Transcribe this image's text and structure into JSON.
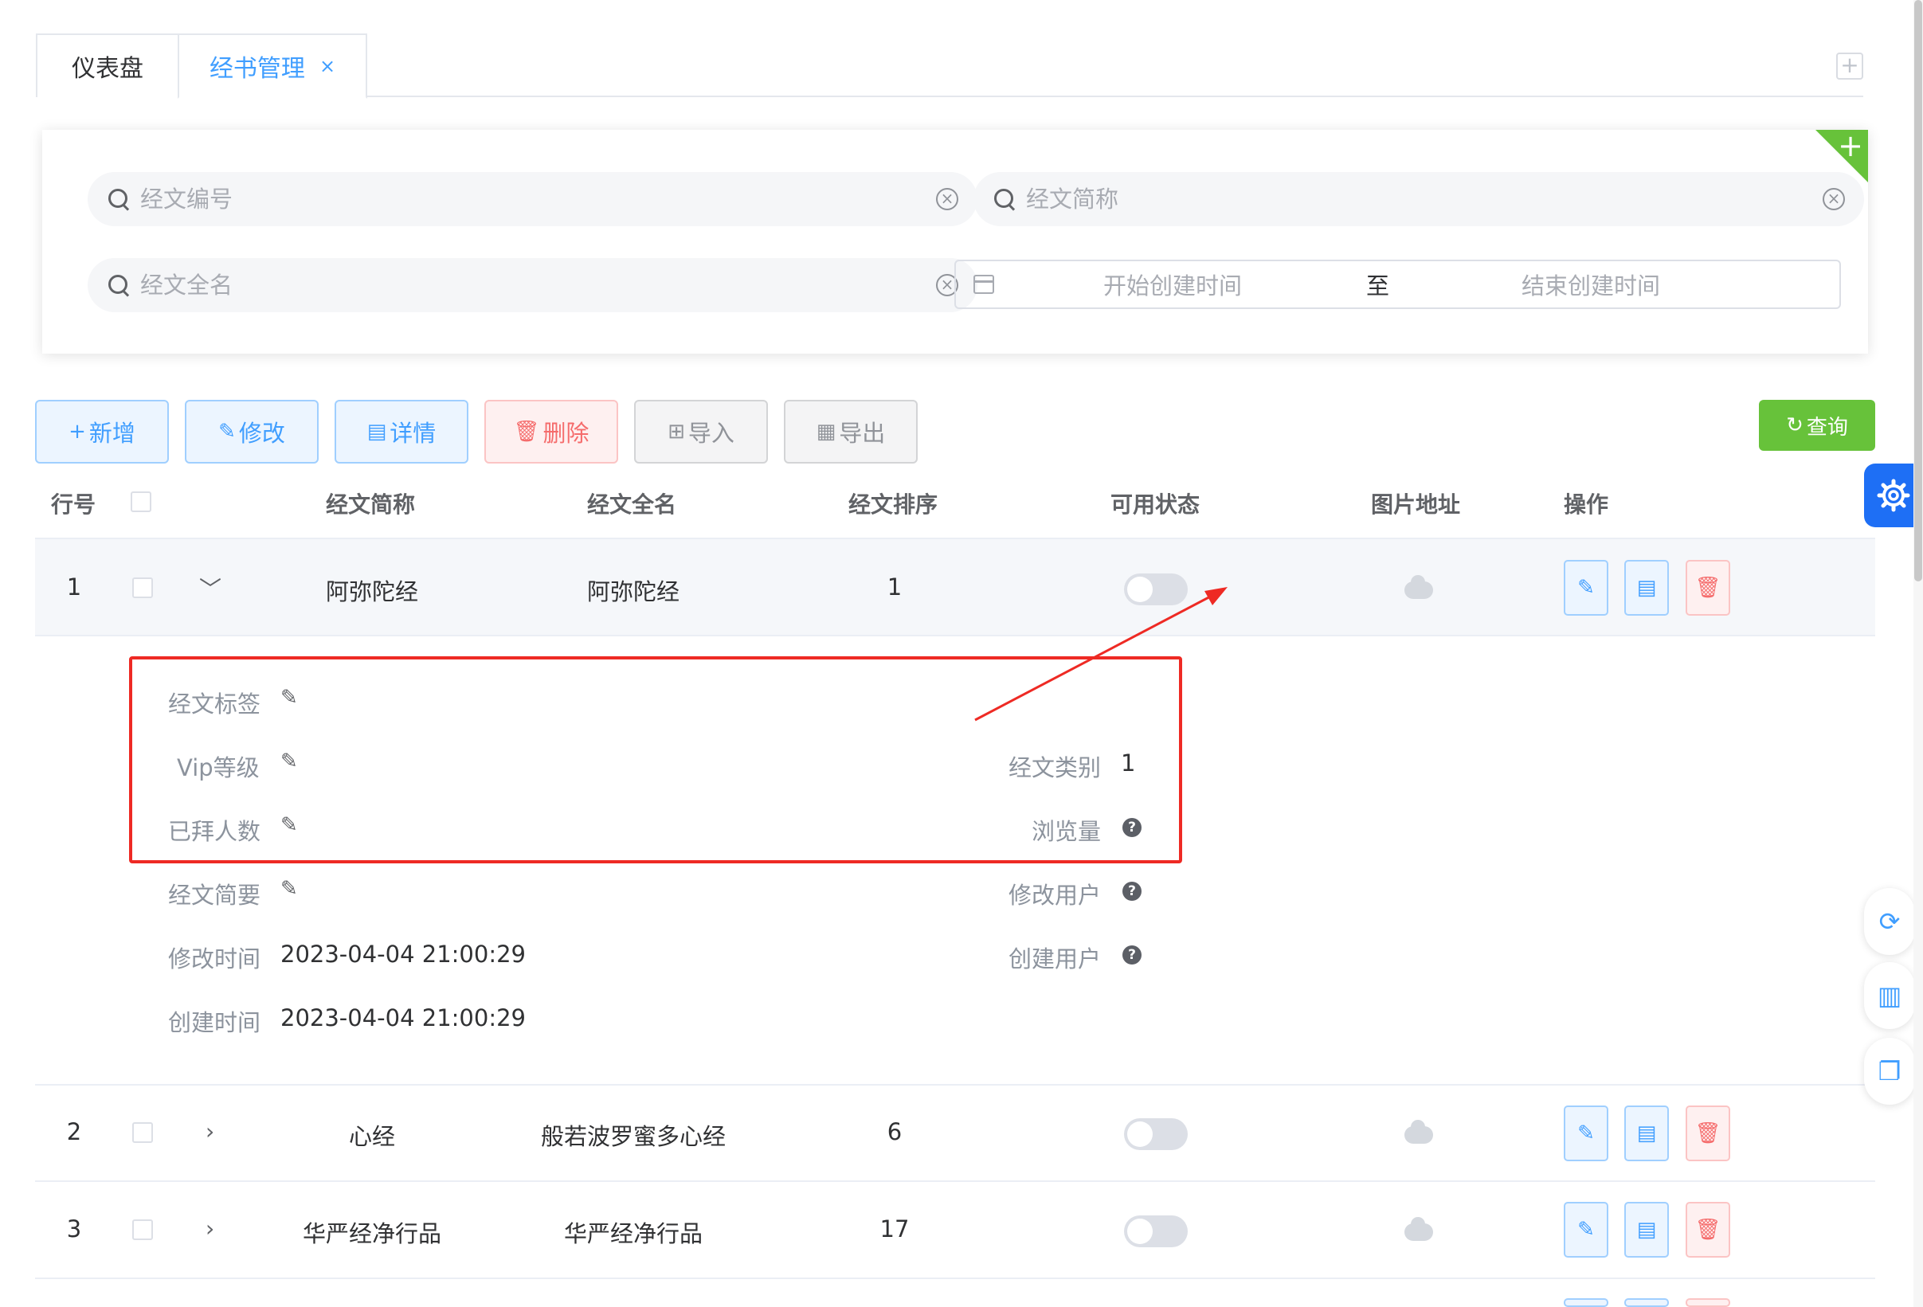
{
  "tabs": [
    {
      "label": "仪表盘"
    },
    {
      "label": "经书管理",
      "close": "×"
    }
  ],
  "search": {
    "number_placeholder": "经文编号",
    "short_name_placeholder": "经文简称",
    "full_name_placeholder": "经文全名",
    "date_start_placeholder": "开始创建时间",
    "date_separator": "至",
    "date_end_placeholder": "结束创建时间"
  },
  "toolbar": {
    "add_label": "新增",
    "edit_label": "修改",
    "detail_label": "详情",
    "delete_label": "删除",
    "import_label": "导入",
    "export_label": "导出",
    "query_label": "查询"
  },
  "table": {
    "headers": [
      "行号",
      "经文简称",
      "经文全名",
      "经文排序",
      "可用状态",
      "图片地址",
      "操作"
    ],
    "rows": [
      {
        "no": "1",
        "short_name": "阿弥陀经",
        "full_name": "阿弥陀经",
        "sort": "1",
        "enabled": false
      },
      {
        "no": "2",
        "short_name": "心经",
        "full_name": "般若波罗蜜多心经",
        "sort": "6",
        "enabled": false
      },
      {
        "no": "3",
        "short_name": "华严经净行品",
        "full_name": "华严经净行品",
        "sort": "17",
        "enabled": false
      }
    ]
  },
  "detail": {
    "tag_label": "经文标签",
    "vip_label": "Vip等级",
    "worship_label": "已拜人数",
    "summary_label": "经文简要",
    "modified_time_label": "修改时间",
    "modified_time_value": "2023-04-04 21:00:29",
    "created_time_label": "创建时间",
    "created_time_value": "2023-04-04 21:00:29",
    "category_label": "经文类别",
    "category_value": "1",
    "views_label": "浏览量",
    "modified_user_label": "修改用户",
    "created_user_label": "创建用户"
  },
  "colors": {
    "primary": "#409eff",
    "success": "#67c23a",
    "danger": "#f56c6c",
    "annotation": "#ee2a24"
  }
}
